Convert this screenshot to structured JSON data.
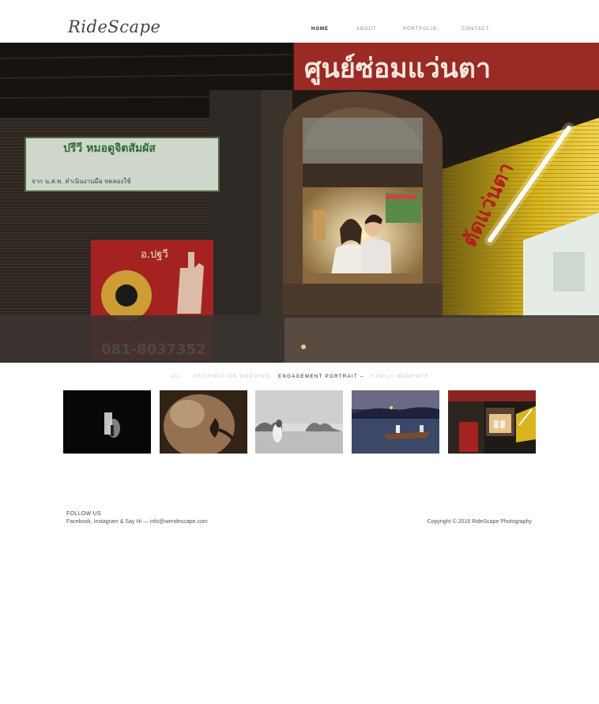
{
  "brand": {
    "logo_text": "RideScape"
  },
  "nav": {
    "items": [
      {
        "label": "HOME",
        "active": true
      },
      {
        "label": "ABOUT",
        "active": false
      },
      {
        "label": "PORTFOLIO",
        "active": false
      },
      {
        "label": "CONTACT",
        "active": false
      }
    ]
  },
  "hero": {
    "sign_top": "ศูนย์ซ่อมแว่นตา",
    "sign_left": "ปรีวี หมอดูจิตสัมผัส",
    "sign_left_small": "จาก น.ส.พ. ดำเนินงานมือ ทดลองใช้",
    "sign_name": "อ.ปฐวี",
    "sign_phone": "081-8037352",
    "sign_right": "ตัดแว่นตา"
  },
  "filters": {
    "items": [
      {
        "label": "ALL",
        "active": false
      },
      {
        "label": "DESTINATION WEDDING",
        "active": false
      },
      {
        "label": "ENGAGEMENT PORTRAIT –",
        "active": true
      },
      {
        "label": "FAMILY MOMENTS",
        "active": false
      }
    ]
  },
  "gallery": {
    "thumbs": [
      {
        "subject": "couple-dark-doorway"
      },
      {
        "subject": "couple-tattoo-closeup"
      },
      {
        "subject": "couple-seaside-bw"
      },
      {
        "subject": "couple-boat-dusk"
      },
      {
        "subject": "couple-shop-window"
      }
    ]
  },
  "footer": {
    "follow_heading": "FOLLOW US",
    "follow_text": "Facebook, Instagram & Say Hi — info@weridescape.com",
    "copyright": "Copyright © 2018 RideScape Photography"
  },
  "colors": {
    "background": "#ffffff",
    "nav_active": "#111111",
    "nav_inactive": "#888888",
    "filter_inactive": "#c8c8c8",
    "hero_yellow": "#d8b51c",
    "hero_red": "#b3231f"
  }
}
